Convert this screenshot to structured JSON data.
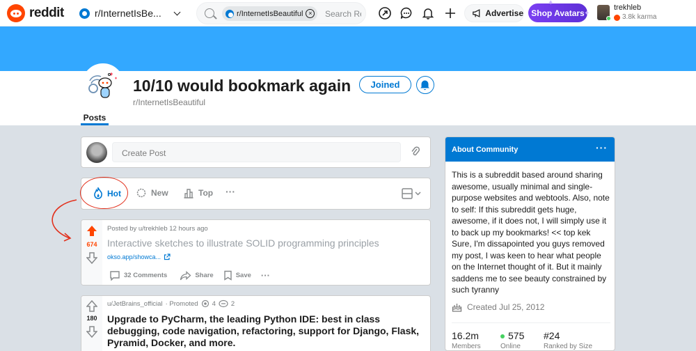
{
  "topbar": {
    "logo_text": "reddit",
    "community_switcher": "r/InternetIsBe...",
    "search": {
      "chip_label": "r/InternetIsBeautiful",
      "placeholder": "Search Re"
    },
    "advertise_label": "Advertise",
    "shop_label": "Shop Avatars",
    "user": {
      "name": "trekhleb",
      "karma": "3.8k karma"
    }
  },
  "community": {
    "title": "10/10 would bookmark again",
    "name": "r/InternetIsBeautiful",
    "joined_label": "Joined",
    "tabs": [
      "Posts"
    ]
  },
  "create_post": {
    "placeholder": "Create Post"
  },
  "sort": {
    "hot": "Hot",
    "new": "New",
    "top": "Top",
    "more": "···"
  },
  "posts": [
    {
      "votes": "674",
      "meta": "Posted by u/trekhleb 12 hours ago",
      "title": "Interactive sketches to illustrate SOLID programming principles",
      "link": "okso.app/showca...",
      "comments": "32 Comments",
      "share": "Share",
      "save": "Save",
      "more": "···"
    },
    {
      "votes": "180",
      "author": "u/JetBrains_official",
      "promoted": "· Promoted",
      "award_count_1": "4",
      "award_count_2": "2",
      "title": "Upgrade to PyCharm, the leading Python IDE: best in class debugging, code navigation, refactoring, support for Django, Flask, Pyramid, Docker, and more."
    }
  ],
  "about": {
    "title": "About Community",
    "more": "···",
    "description": "This is a subreddit based around sharing awesome, usually minimal and single-purpose websites and webtools. Also, note to self: If this subreddit gets huge, awesome, if it does not, I will simply use it to back up my bookmarks! << top kek Sure, I'm dissapointed you guys removed my post, I was keen to hear what people on the Internet thought of it. But it mainly saddens me to see beauty constrained by such tyranny",
    "created": "Created Jul 25, 2012",
    "stats": [
      {
        "value": "16.2m",
        "label": "Members"
      },
      {
        "value": "575",
        "label": "Online"
      },
      {
        "value": "#24",
        "label": "Ranked by Size"
      }
    ]
  },
  "colors": {
    "brand": "#ff4500",
    "accent": "#0079d3",
    "banner": "#33a8ff",
    "annotation": "#e2311d"
  }
}
